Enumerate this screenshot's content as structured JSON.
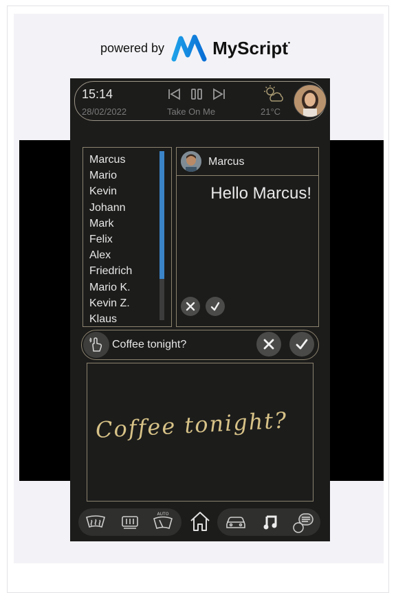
{
  "brand": {
    "powered_by": "powered by",
    "name": "MyScript"
  },
  "status_bar": {
    "time": "15:14",
    "date": "28/02/2022",
    "song": "Take On Me",
    "temperature": "21°C",
    "weather_icon": "sun-cloud-icon"
  },
  "contacts": {
    "names": [
      "Marcus",
      "Mario",
      "Kevin",
      "Johann",
      "Mark",
      "Felix",
      "Alex",
      "Friedrich",
      "Mario K.",
      "Kevin Z.",
      "Klaus"
    ],
    "scroll_position": 0.0
  },
  "chat": {
    "contact_name": "Marcus",
    "message": "Hello Marcus!"
  },
  "input": {
    "recognized_text": "Coffee tonight?",
    "handwriting": "Coffee tonight?"
  },
  "bottom_nav": {
    "icons": [
      "rear-defrost-icon",
      "front-defrost-icon",
      "auto-wiper-icon",
      "home-icon",
      "car-icon",
      "music-note-icon",
      "message-icon"
    ],
    "auto_label": "AUTO"
  },
  "colors": {
    "accent": "#3b84c7",
    "frame": "#8d846f",
    "ink": "#d7c287",
    "background": "#1c1c1b"
  }
}
